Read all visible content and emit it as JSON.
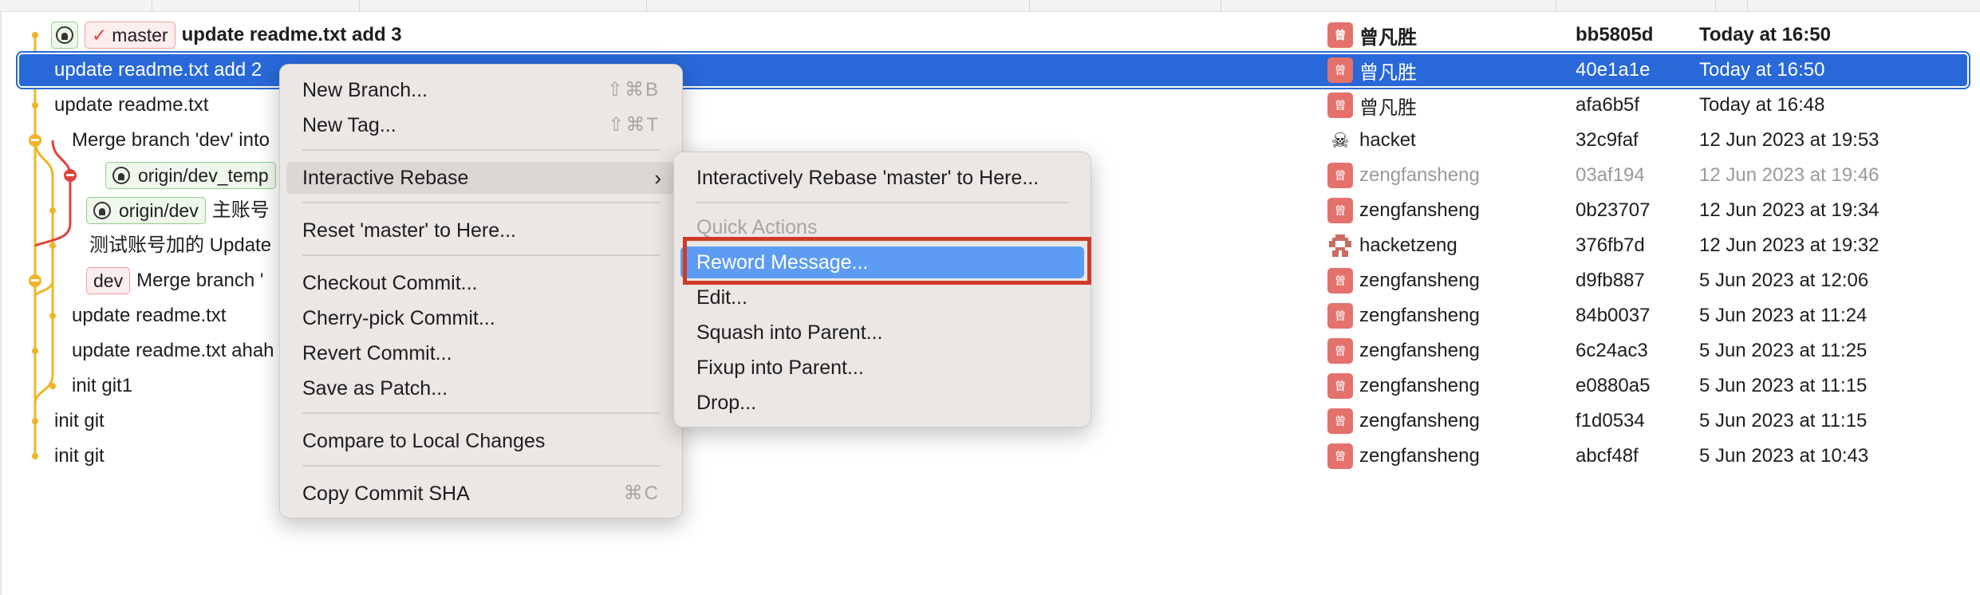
{
  "commits": [
    {
      "msg": "update readme.txt add 3",
      "author": "曾凡胜",
      "avatar": "曾",
      "sha": "bb5805d",
      "date": "Today at 16:50",
      "badges": [
        {
          "type": "github",
          "label": ""
        },
        {
          "type": "check",
          "label": "master"
        }
      ]
    },
    {
      "msg": "update readme.txt add 2",
      "author": "曾凡胜",
      "avatar": "曾",
      "sha": "40e1a1e",
      "date": "Today at 16:50",
      "badges": []
    },
    {
      "msg": "update readme.txt",
      "author": "曾凡胜",
      "avatar": "曾",
      "sha": "afa6b5f",
      "date": "Today at 16:48",
      "badges": []
    },
    {
      "msg": "Merge branch 'dev' into",
      "author": "hacket",
      "avatar": "hacket",
      "sha": "32c9faf",
      "date": "12 Jun 2023 at 19:53",
      "badges": []
    },
    {
      "msg": "",
      "author": "zengfansheng",
      "avatar": "曾",
      "sha": "03af194",
      "date": "12 Jun 2023 at 19:46",
      "badges": [
        {
          "type": "github",
          "label": "origin/dev_temp"
        }
      ]
    },
    {
      "msg": "主账号",
      "author": "zengfansheng",
      "avatar": "曾",
      "sha": "0b23707",
      "date": "12 Jun 2023 at 19:34",
      "badges": [
        {
          "type": "github",
          "label": "origin/dev"
        }
      ]
    },
    {
      "msg": "测试账号加的 Update",
      "author": "hacketzeng",
      "avatar": "pixel",
      "sha": "376fb7d",
      "date": "12 Jun 2023 at 19:32",
      "badges": []
    },
    {
      "msg": "Merge branch '",
      "author": "zengfansheng",
      "avatar": "曾",
      "sha": "d9fb887",
      "date": "5 Jun 2023 at 12:06",
      "badges": [
        {
          "type": "red",
          "label": "dev"
        }
      ]
    },
    {
      "msg": "update readme.txt",
      "author": "zengfansheng",
      "avatar": "曾",
      "sha": "84b0037",
      "date": "5 Jun 2023 at 11:24",
      "badges": []
    },
    {
      "msg": "update readme.txt ahah",
      "author": "zengfansheng",
      "avatar": "曾",
      "sha": "6c24ac3",
      "date": "5 Jun 2023 at 11:25",
      "badges": []
    },
    {
      "msg": "init git1",
      "author": "zengfansheng",
      "avatar": "曾",
      "sha": "e0880a5",
      "date": "5 Jun 2023 at 11:15",
      "badges": []
    },
    {
      "msg": "init git",
      "author": "zengfansheng",
      "avatar": "曾",
      "sha": "f1d0534",
      "date": "5 Jun 2023 at 11:15",
      "badges": []
    },
    {
      "msg": "init git",
      "author": "zengfansheng",
      "avatar": "曾",
      "sha": "abcf48f",
      "date": "5 Jun 2023 at 10:43",
      "badges": []
    }
  ],
  "context_menu": {
    "new_branch": "New Branch...",
    "new_branch_sc": "⇧⌘B",
    "new_tag": "New Tag...",
    "new_tag_sc": "⇧⌘T",
    "interactive_rebase": "Interactive Rebase",
    "reset": "Reset 'master' to Here...",
    "checkout": "Checkout Commit...",
    "cherry_pick": "Cherry-pick Commit...",
    "revert": "Revert Commit...",
    "save_patch": "Save as Patch...",
    "compare": "Compare to Local Changes",
    "copy_sha": "Copy Commit SHA",
    "copy_sha_sc": "⌘C"
  },
  "submenu": {
    "rebase_here": "Interactively Rebase 'master' to Here...",
    "quick_actions": "Quick Actions",
    "reword": "Reword Message...",
    "edit": "Edit...",
    "squash": "Squash into Parent...",
    "fixup": "Fixup into Parent...",
    "drop": "Drop..."
  },
  "colors": {
    "selection": "#2868d8",
    "highlight": "#5d9cf2",
    "graph_orange": "#f0b429",
    "graph_red": "#e0413b"
  }
}
